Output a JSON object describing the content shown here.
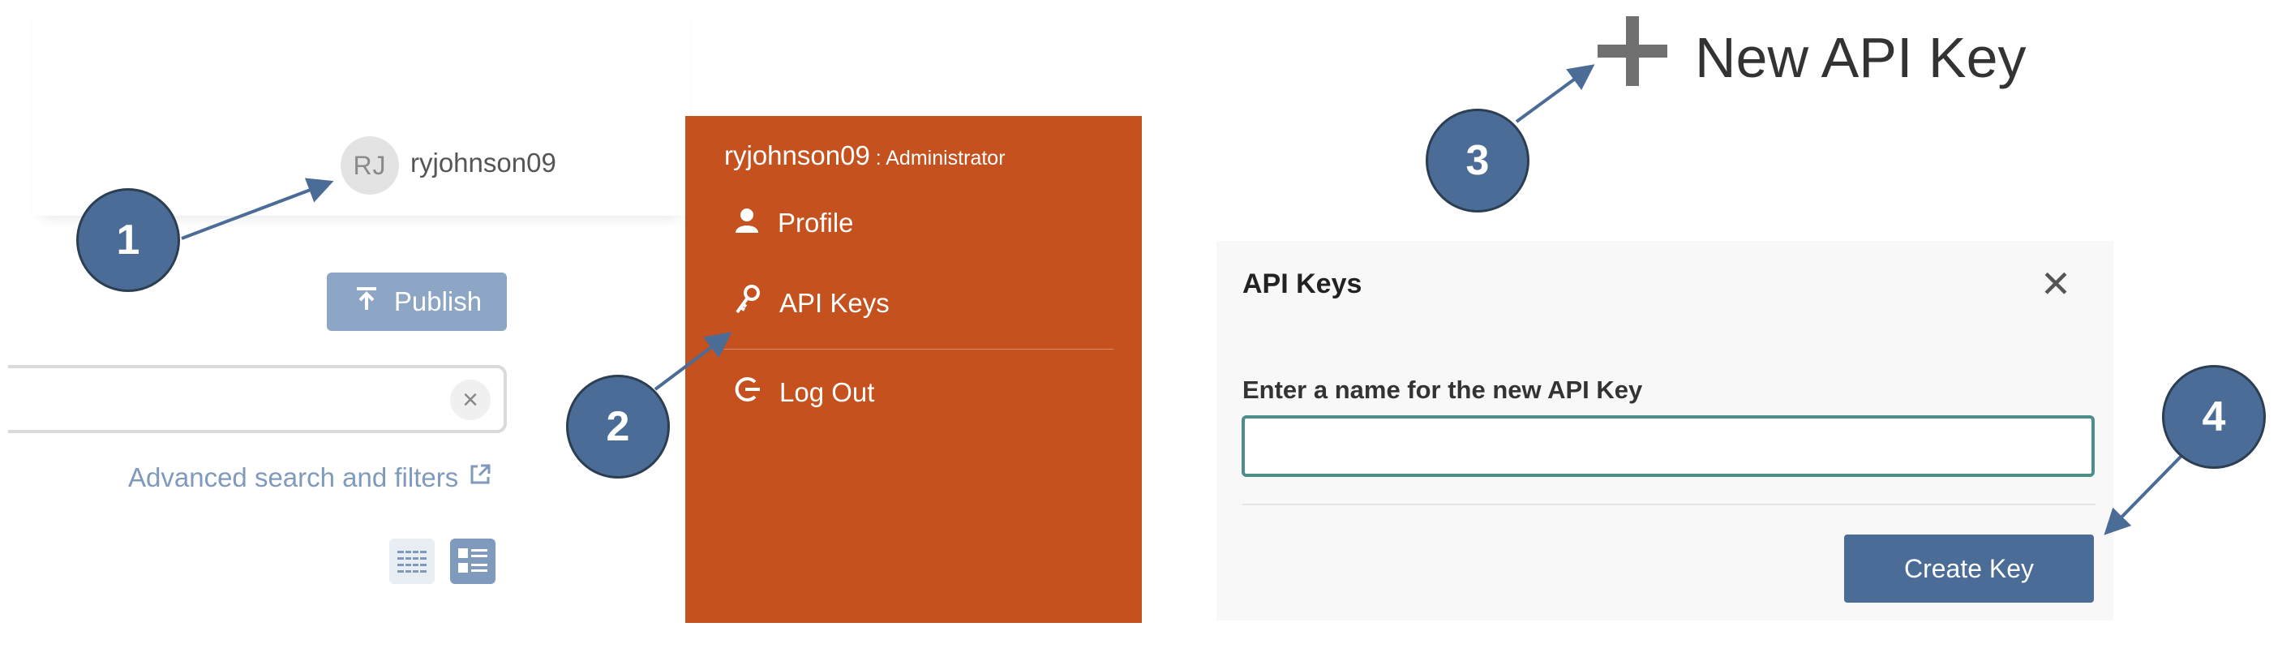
{
  "panel1": {
    "avatar_initials": "RJ",
    "username": "ryjohnson09",
    "publish_label": "Publish",
    "clear_symbol": "×",
    "advanced_search_label": "Advanced search and filters",
    "icons": [
      "upload-icon",
      "close-icon",
      "external-link-icon",
      "grid-view-icon",
      "list-view-icon"
    ]
  },
  "menu": {
    "username": "ryjohnson09",
    "role": " : Administrator",
    "items": [
      {
        "label": "Profile",
        "icon": "user-icon"
      },
      {
        "label": "API Keys",
        "icon": "key-icon"
      },
      {
        "label": "Log Out",
        "icon": "logout-icon"
      }
    ],
    "background_color": "#c5511f"
  },
  "new_api_key": {
    "label": "New API Key",
    "icon": "plus-icon"
  },
  "dialog": {
    "title": "API Keys",
    "close_symbol": "✕",
    "field_label": "Enter a name for the new API Key",
    "field_value": "",
    "create_label": "Create Key"
  },
  "callouts": [
    "1",
    "2",
    "3",
    "4"
  ],
  "colors": {
    "callout": "#4a6c96",
    "accent_input": "#4c8f8a",
    "publish": "#8ea6c6"
  }
}
